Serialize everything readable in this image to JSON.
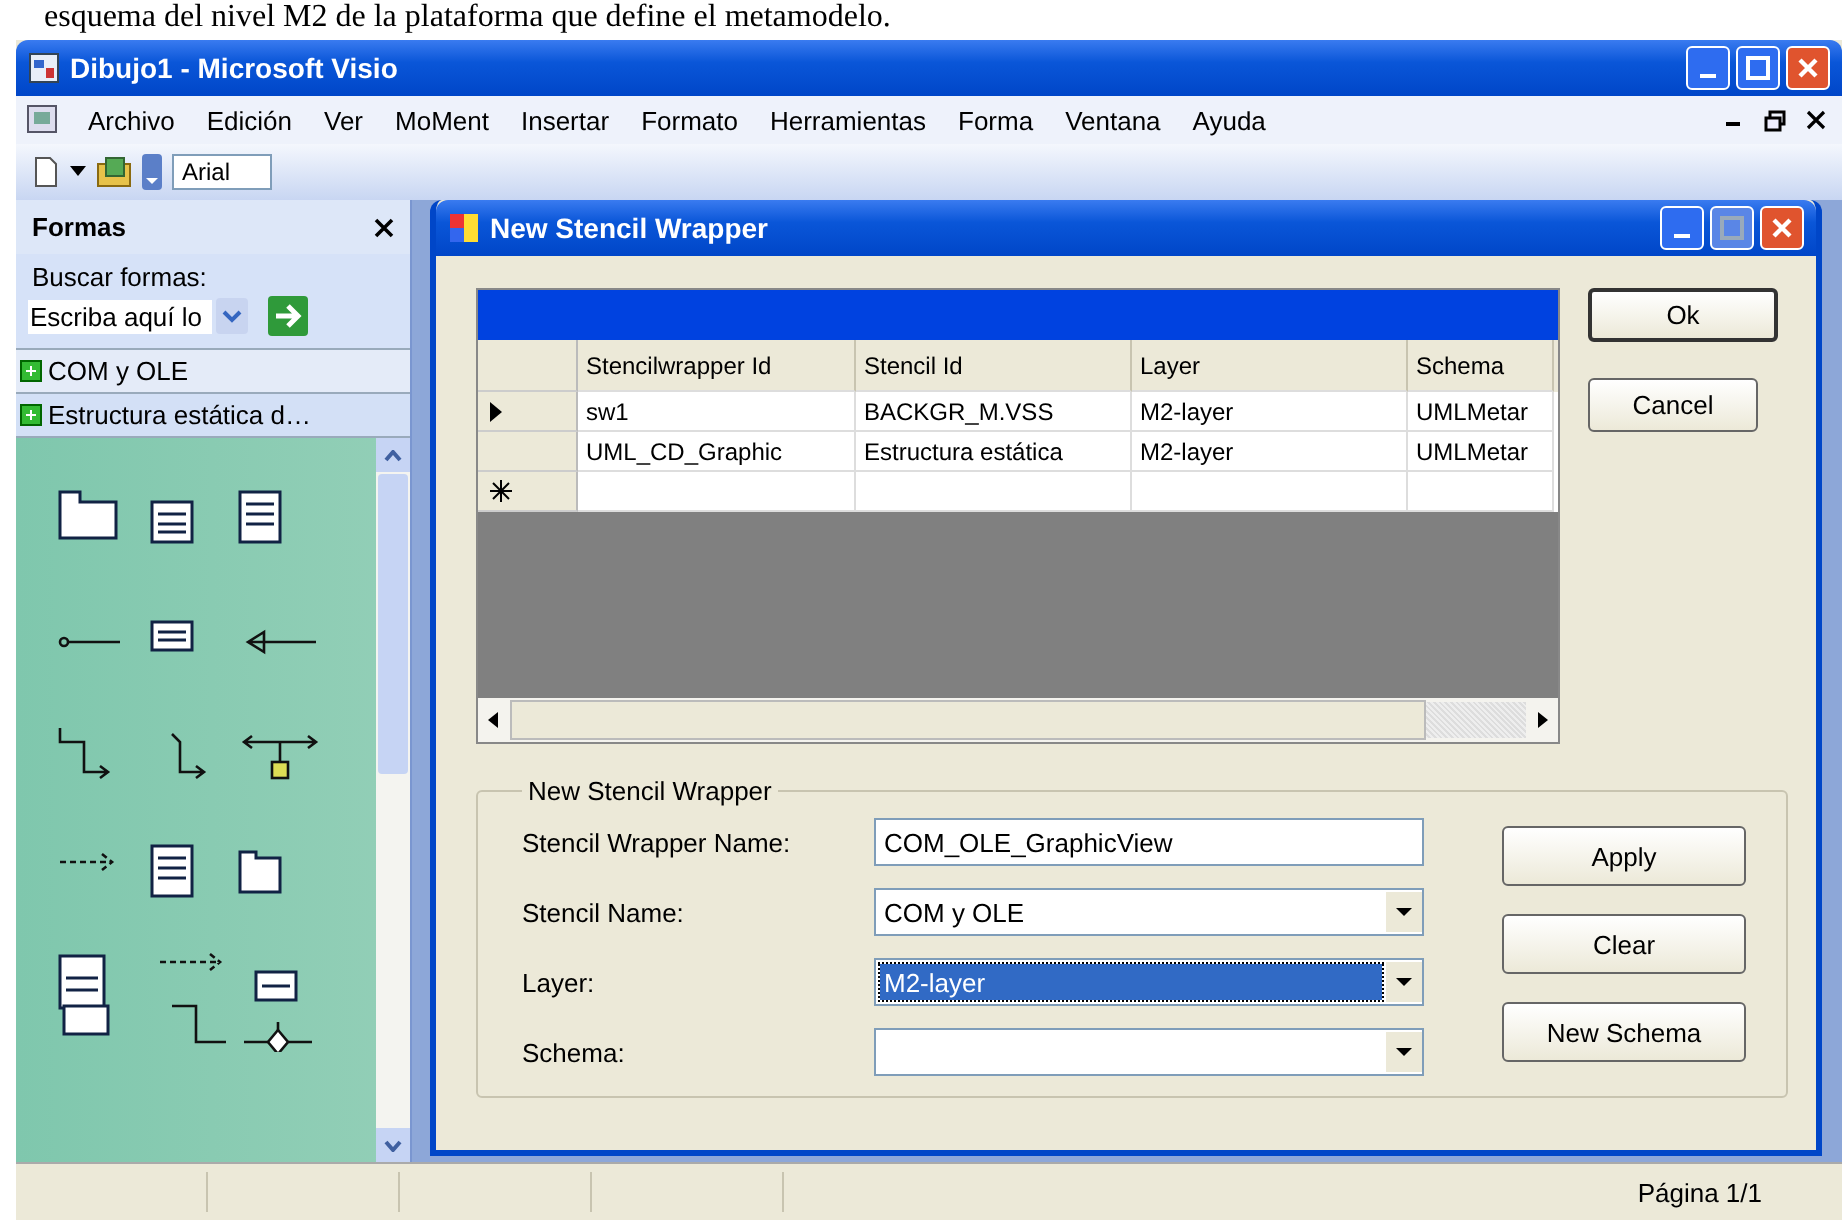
{
  "document_text": "esquema del nivel M2 de la plataforma que define el metamodelo.",
  "window": {
    "title": "Dibujo1 - Microsoft Visio"
  },
  "menu": [
    "Archivo",
    "Edición",
    "Ver",
    "MoMent",
    "Insertar",
    "Formato",
    "Herramientas",
    "Forma",
    "Ventana",
    "Ayuda"
  ],
  "toolbar": {
    "font": "Arial"
  },
  "shapes_panel": {
    "title": "Formas",
    "search_label": "Buscar formas:",
    "search_value": "Escriba aquí lo",
    "stencils": [
      {
        "label": "COM y OLE",
        "selected": false
      },
      {
        "label": "Estructura estática d…",
        "selected": true
      }
    ]
  },
  "dialog": {
    "title": "New Stencil Wrapper",
    "grid": {
      "columns": [
        "Stencilwrapper Id",
        "Stencil Id",
        "Layer",
        "Schema"
      ],
      "rows": [
        {
          "cells": [
            "sw1",
            "BACKGR_M.VSS",
            "M2-layer",
            "UMLMetar"
          ],
          "current": true
        },
        {
          "cells": [
            "UML_CD_Graphic",
            "Estructura estática",
            "M2-layer",
            "UMLMetar"
          ],
          "current": false
        }
      ]
    },
    "side_buttons": [
      "Ok",
      "Cancel"
    ],
    "group": {
      "title": "New Stencil Wrapper",
      "fields": [
        {
          "label": "Stencil Wrapper Name:",
          "kind": "text",
          "value": "COM_OLE_GraphicView",
          "selected": false
        },
        {
          "label": "Stencil Name:",
          "kind": "combo",
          "value": "COM y OLE",
          "selected": false
        },
        {
          "label": "Layer:",
          "kind": "combo",
          "value": "M2-layer",
          "selected": true
        },
        {
          "label": "Schema:",
          "kind": "combo",
          "selected": false
        }
      ],
      "buttons": [
        "Apply",
        "Clear",
        "New Schema"
      ]
    }
  },
  "status_bar": {
    "page": "Página 1/1"
  }
}
